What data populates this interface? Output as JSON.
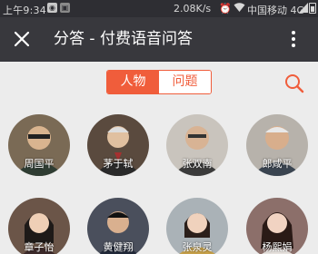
{
  "status_bar": {
    "time": "上午9:34",
    "speed": "2.08K/s",
    "carrier": "中国移动 4G"
  },
  "header": {
    "title": "分答 - 付费语音问答",
    "close_icon": "close-icon",
    "more_icon": "more-vertical-icon"
  },
  "tabs": [
    {
      "label": "人物",
      "active": true
    },
    {
      "label": "问题",
      "active": false
    }
  ],
  "search_icon": "search-icon",
  "accent_color": "#f05d3b",
  "people": [
    {
      "name": "周国平"
    },
    {
      "name": "茅于轼"
    },
    {
      "name": "张双南"
    },
    {
      "name": "郎咸平"
    },
    {
      "name": "章子怡"
    },
    {
      "name": "黄健翔"
    },
    {
      "name": "张泉灵"
    },
    {
      "name": "杨熙娟"
    }
  ]
}
